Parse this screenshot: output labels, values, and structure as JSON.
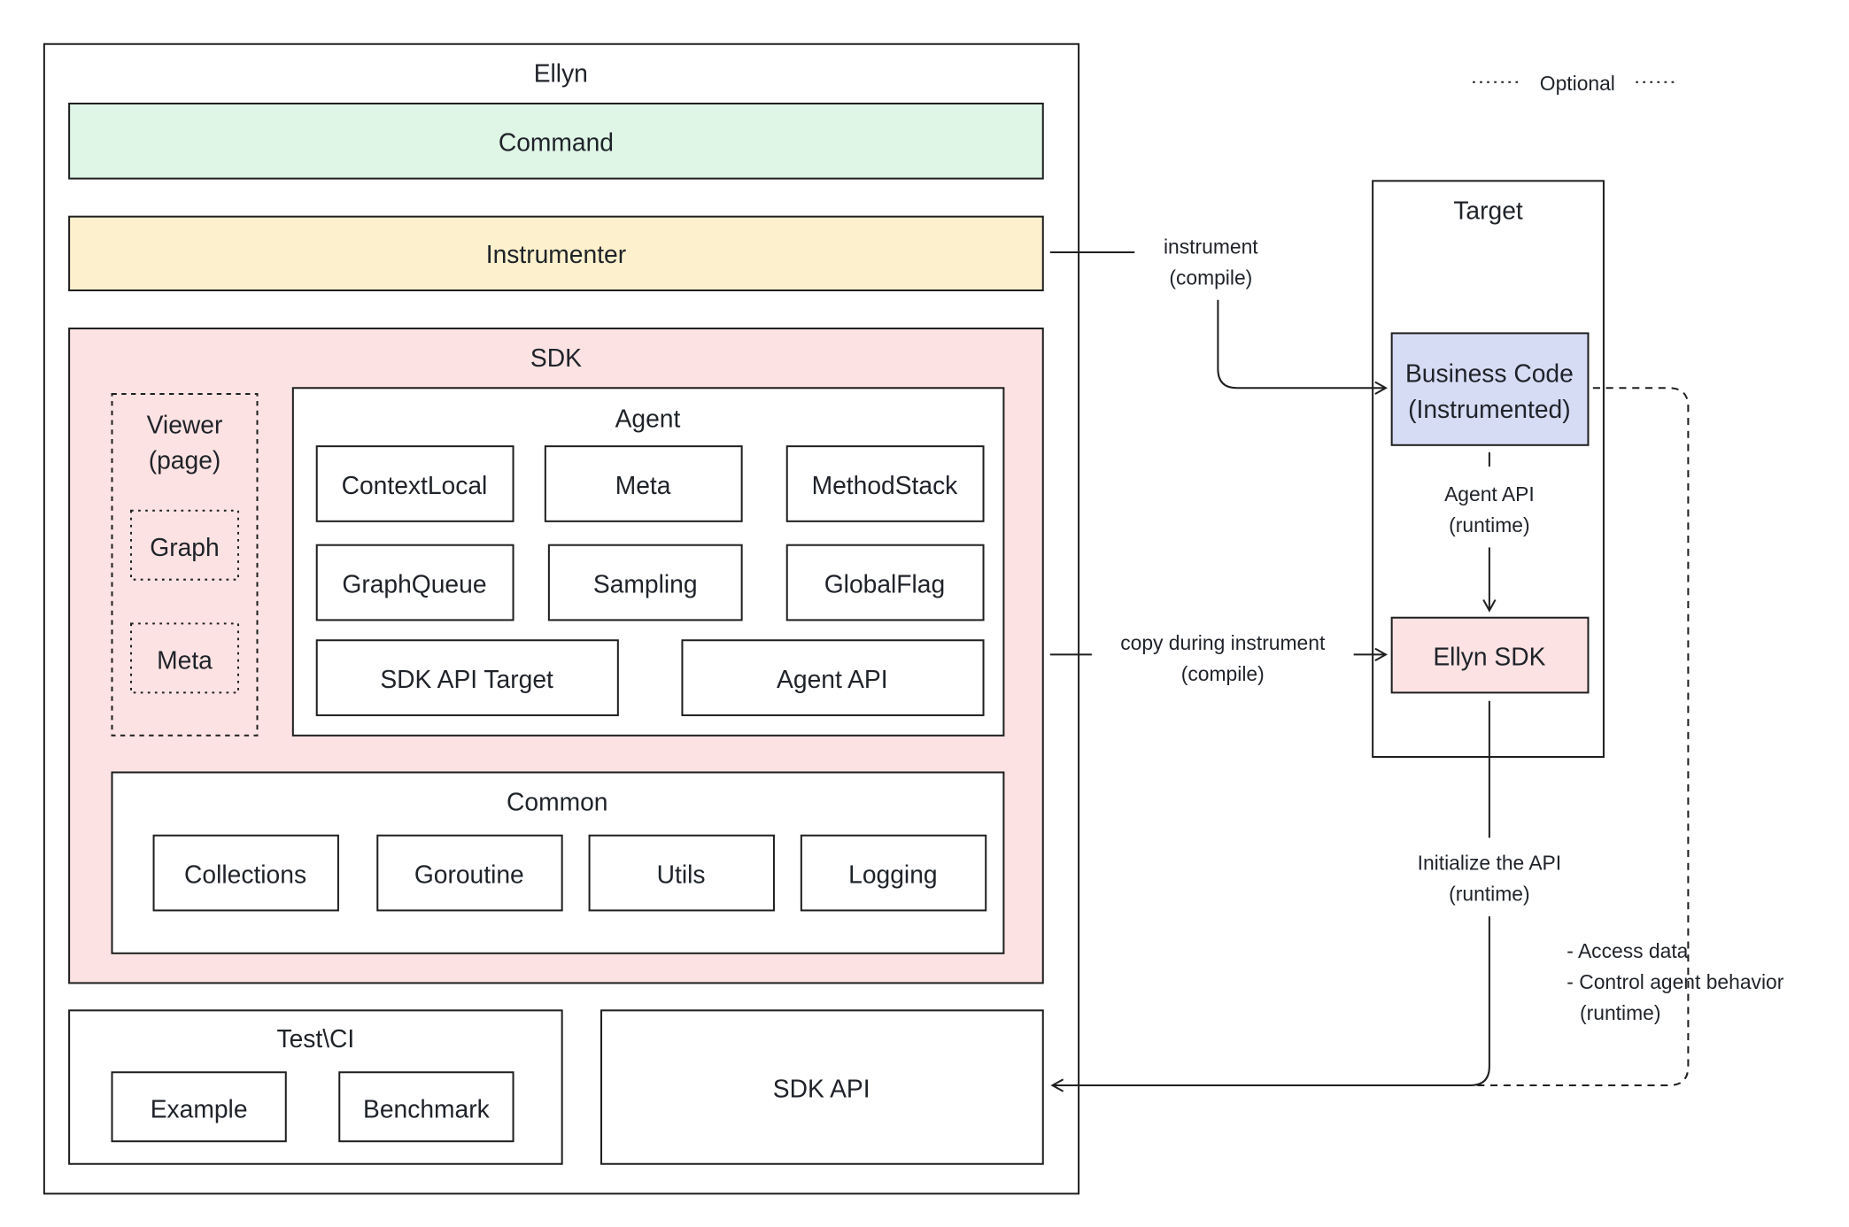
{
  "legend": {
    "optional_label": "Optional"
  },
  "colors": {
    "command_fill": "#dff5e6",
    "instrumenter_fill": "#fdf0cc",
    "sdk_fill": "#fde2e3",
    "business_code_fill": "#d7dcf5",
    "ellyn_sdk_fill": "#fde2e3"
  },
  "ellyn": {
    "title": "Ellyn",
    "command": "Command",
    "instrumenter": "Instrumenter",
    "sdk": {
      "title": "SDK",
      "viewer": {
        "title_line1": "Viewer",
        "title_line2": "(page)",
        "items": [
          "Graph",
          "Meta"
        ]
      },
      "agent": {
        "title": "Agent",
        "items": [
          "ContextLocal",
          "Meta",
          "MethodStack",
          "GraphQueue",
          "Sampling",
          "GlobalFlag",
          "SDK API Target",
          "Agent API"
        ]
      },
      "common": {
        "title": "Common",
        "items": [
          "Collections",
          "Goroutine",
          "Utils",
          "Logging"
        ]
      }
    },
    "test_ci": {
      "title": "Test\\CI",
      "items": [
        "Example",
        "Benchmark"
      ]
    },
    "sdk_api": "SDK API"
  },
  "target": {
    "title": "Target",
    "business_code_line1": "Business Code",
    "business_code_line2": "(Instrumented)",
    "ellyn_sdk": "Ellyn SDK"
  },
  "edges": {
    "instrument": {
      "line1": "instrument",
      "line2": "(compile)"
    },
    "copy": {
      "line1": "copy during instrument",
      "line2": "(compile)"
    },
    "agent_api": {
      "line1": "Agent API",
      "line2": "(runtime)"
    },
    "init_api": {
      "line1": "Initialize the API",
      "line2": "(runtime)"
    },
    "access": {
      "line1": "- Access data",
      "line2": "- Control agent behavior",
      "line3": "(runtime)"
    }
  }
}
